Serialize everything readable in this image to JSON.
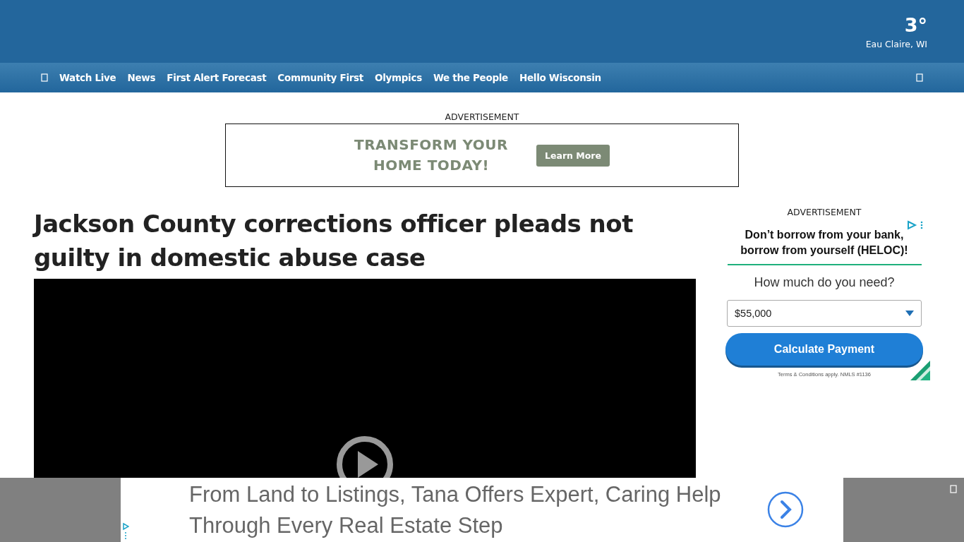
{
  "weather": {
    "temperature": "3°",
    "location": "Eau Claire, WI"
  },
  "nav": {
    "items": [
      {
        "label": "Watch Live"
      },
      {
        "label": "News"
      },
      {
        "label": "First Alert Forecast"
      },
      {
        "label": "Community First"
      },
      {
        "label": "Olympics"
      },
      {
        "label": "We the People"
      },
      {
        "label": "Hello Wisconsin"
      }
    ]
  },
  "top_ad": {
    "label": "ADVERTISEMENT",
    "headline": [
      "TRANSFORM YOUR",
      "HOME TODAY!"
    ],
    "button": "Learn More"
  },
  "article": {
    "title": "Jackson County corrections officer pleads not guilty in domestic abuse case",
    "video": {
      "kind": "player"
    }
  },
  "side_ad": {
    "label": "ADVERTISEMENT",
    "headline": "Don’t borrow from your bank, borrow from yourself (HELOC)!",
    "question": "How much do you need?",
    "amount": "$55,000",
    "button": "Calculate Payment",
    "terms": "Terms & Conditions apply. NMLS #1136"
  },
  "bottom_ad": {
    "text": "From Land to Listings, Tana Offers Expert, Caring Help Through Every Real Estate Step"
  }
}
